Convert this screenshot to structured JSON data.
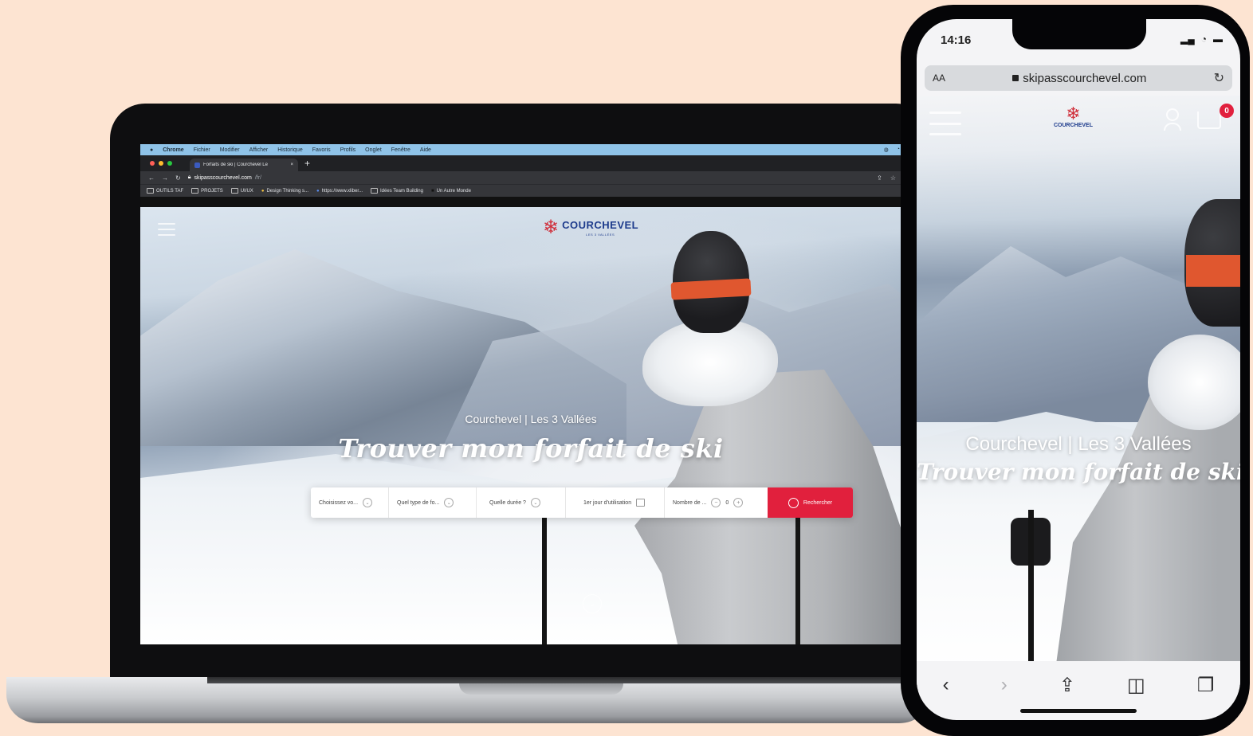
{
  "laptop": {
    "menubar": {
      "apple": "",
      "app": "Chrome",
      "items": [
        "Fichier",
        "Modifier",
        "Afficher",
        "Historique",
        "Favoris",
        "Profils",
        "Onglet",
        "Fenêtre",
        "Aide"
      ]
    },
    "tab": {
      "title": "Forfaits de ski | Courchevel Le",
      "close": "×",
      "new": "+"
    },
    "address": {
      "host": "skipasscourchevel.com",
      "path": "/fr/"
    },
    "bookmarks": [
      "OUTILS TAF",
      "PROJETS",
      "UI/UX",
      "Design Thinking s...",
      "https://www.xliber...",
      "Idées Team Building",
      "Un Autre Monde"
    ],
    "site": {
      "logo_name": "COURCHEVEL",
      "logo_sub": "LES 3 VALLÉES",
      "subtitle": "Courchevel | Les 3 Vallées",
      "title": "Trouver mon forfait de ski",
      "search": {
        "destination": "Choisissez vo...",
        "type": "Quel type de fo...",
        "duration": "Quelle durée ?",
        "date": "1er jour d'utilisation",
        "count_label": "Nombre de ...",
        "count_value": "0",
        "button": "Rechercher"
      }
    }
  },
  "phone": {
    "time": "14:16",
    "aa": "AA",
    "url": "skipasscourchevel.com",
    "logo_name": "COURCHEVEL",
    "cart_count": "0",
    "subtitle": "Courchevel | Les 3 Vallées",
    "title": "Trouver mon forfait de ski"
  },
  "colors": {
    "background": "#fde4d2",
    "accent": "#e1203d",
    "brand_blue": "#1d3b8c",
    "brand_red": "#d0303c"
  }
}
